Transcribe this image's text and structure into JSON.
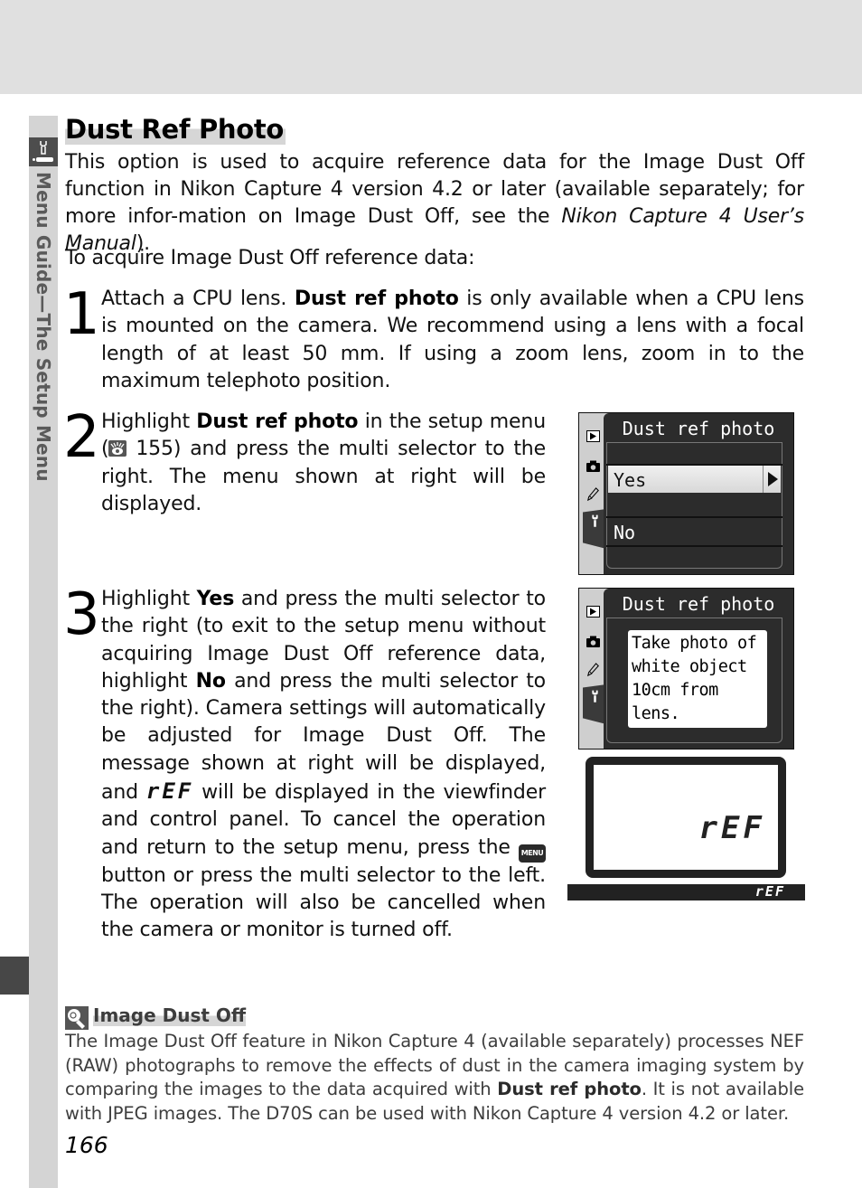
{
  "side_label": "Menu Guide—The Setup Menu",
  "title": "Dust Ref Photo",
  "intro": {
    "text_before": "This option is used to acquire reference data for the Image Dust Off function in Nikon Capture 4 version 4.2 or later (available separately; for more infor-mation on Image Dust Off, see the ",
    "italic": "Nikon Capture 4 User’s Manual",
    "text_after": ")."
  },
  "intro2": "To acquire Image Dust Off reference data:",
  "steps": [
    {
      "number": "1",
      "t1": "Attach a CPU lens.  ",
      "b1": "Dust ref photo",
      "t2": " is only available when a CPU lens is mounted on the camera.  We recommend using a lens with a focal length of at least 50 mm.  If using a zoom lens, zoom in to the maximum telephoto position."
    },
    {
      "number": "2",
      "t1": "Highlight ",
      "b1": "Dust ref photo",
      "t2": " in the setup menu (",
      "ref_page": " 155",
      "t3": ") and press the multi selector to the right.  The menu shown at right will be displayed."
    },
    {
      "number": "3",
      "t1": "Highlight ",
      "b1": "Yes",
      "t2": " and press the multi selector to the right (to exit to the setup menu without acquiring Image Dust Off reference data, highlight ",
      "b2": "No",
      "t3": " and press the multi selector to the right).  Camera settings will automatically be adjusted for Image Dust Off.  The message shown at right will be displayed, and ",
      "segment_text": "rEF",
      "t4": " will be displayed in the viewfinder and control panel.  To cancel the operation and return to the setup menu, press the ",
      "menu_button": "MENU",
      "t5": " button or press the multi selector to the left.  The operation will also be cancelled when the camera or monitor is turned off."
    }
  ],
  "screens": {
    "menu": {
      "title": "Dust ref photo",
      "options": [
        "Yes",
        "No"
      ],
      "selected": "Yes"
    },
    "message": {
      "title": "Dust ref photo",
      "text": "Take photo of\nwhite object\n10cm from\nlens."
    },
    "control_panel": {
      "display": "rEF"
    },
    "viewfinder": {
      "display": "rEF"
    }
  },
  "note": {
    "title": "Image Dust Off",
    "t1": "The Image Dust Off feature in Nikon Capture 4 (available separately) processes NEF (RAW) photographs to remove the effects of dust in the camera imaging system by comparing the images to the data acquired with ",
    "b1": "Dust ref photo",
    "t2": ".  It is not available with JPEG images.  The D70S can be used with Nikon Capture 4 version 4.2 or later."
  },
  "page_number": "166"
}
